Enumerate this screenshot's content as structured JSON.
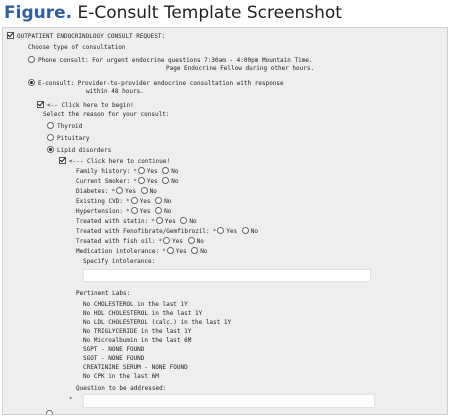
{
  "figure": {
    "label": "Figure.",
    "title": "E-Consult Template Screenshot"
  },
  "form": {
    "section_title": "OUTPATIENT ENDOCRINOLOGY CONSULT REQUEST:",
    "type_prompt": "Choose type of consultation",
    "phone_option": {
      "line1": "Phone consult: For urgent endocrine questions 7:30am - 4:00pm Mountain Time.",
      "line2": "Page Endocrine Fellow during other hours."
    },
    "econsult_option": {
      "line1": "E-consult: Provider-to-provider endocrine consultation with response",
      "line2": "within 48 hours."
    },
    "begin_label": "<-- Click here to begin!",
    "reason_prompt": "Select the reason for your consult:",
    "reasons": [
      "Thyroid",
      "Pituitary",
      "Lipid disorders"
    ],
    "continue_label": "<--- Click here to continue!",
    "questions": [
      "Family history:",
      "Current Smoker:",
      "Diabetes:",
      "Existing CVD:",
      "Hypertension:",
      "Treated with statin:",
      "Treated with Fenofibrate/Gemfibrozil:",
      "Treated with fish oil:",
      "Medication intolerance:"
    ],
    "required_mark": "*",
    "yes_label": "Yes",
    "no_label": "No",
    "intolerance_label": "Specify intolerance:",
    "labs_title": "Pertinent Labs:",
    "labs": [
      "No CHOLESTEROL in the last 1Y",
      "No HDL CHOLESTEROL in the last 1Y",
      "No LDL CHOLESTEROL (calc.) in the last 1Y",
      "No TRIGLYCERIDE in the last 1Y",
      "No Microalbumin in the last 6M",
      "SGPT - NONE FOUND",
      "SGOT - NONE FOUND",
      "CREATININE SERUM - NONE FOUND",
      "No CPK in the last 6M"
    ],
    "question_label": "Question to be addressed:"
  }
}
